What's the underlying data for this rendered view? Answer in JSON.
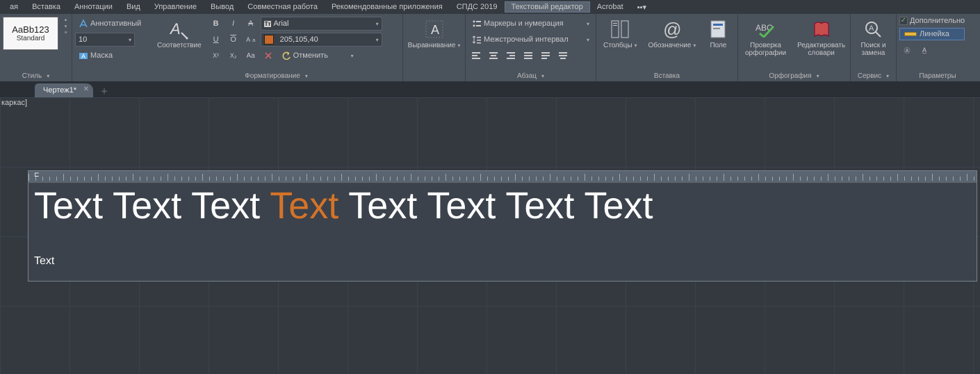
{
  "menu": {
    "items": [
      "ая",
      "Вставка",
      "Аннотации",
      "Вид",
      "Управление",
      "Вывод",
      "Совместная работа",
      "Рекомендованные приложения",
      "СПДС 2019",
      "Текстовый редактор",
      "Acrobat"
    ],
    "active_index": 9
  },
  "ribbon": {
    "style": {
      "preview": "AaBb123",
      "preview_label": "Standard",
      "panel_title": "Стиль",
      "annotative": "Аннотативный",
      "size": "10",
      "mask": "Маска"
    },
    "format": {
      "panel_title": "Форматирование",
      "match_label": "Соответствие",
      "font": "Arial",
      "color_text": "205,105,40",
      "cancel": "Отменить"
    },
    "align": {
      "panel_title": "Выравнивание"
    },
    "paragraph": {
      "panel_title": "Абзац",
      "bullets": "Маркеры и нумерация",
      "linespacing": "Межстрочный интервал"
    },
    "insert": {
      "panel_title": "Вставка",
      "columns": "Столбцы",
      "symbol": "Обозначение",
      "field": "Поле"
    },
    "spell": {
      "panel_title": "Орфография",
      "check": "Проверка\nорфографии",
      "dict": "Редактировать\nсловари"
    },
    "tools": {
      "panel_title": "Сервис",
      "find": "Поиск и\nзамена"
    },
    "options": {
      "panel_title": "Параметры",
      "extra": "Дополнительно",
      "ruler": "Линейка"
    }
  },
  "tabs": {
    "items": [
      "Чертеж1*"
    ]
  },
  "canvas": {
    "status": "каркас]",
    "editor": {
      "line1_words": [
        "Text",
        "Text",
        "Text",
        "Text",
        "Text",
        "Text",
        "Text",
        "Text"
      ],
      "highlight_index": 3,
      "line2": "Text"
    }
  }
}
